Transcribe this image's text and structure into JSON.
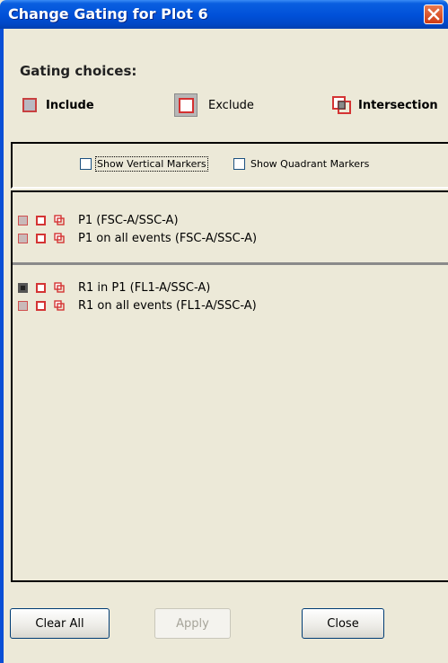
{
  "window": {
    "title": "Change Gating for Plot 6"
  },
  "gating": {
    "heading": "Gating choices:",
    "choices": [
      {
        "label": "Include"
      },
      {
        "label": "Exclude"
      },
      {
        "label": "Intersection"
      }
    ]
  },
  "markers": {
    "vertical_label": "Show Vertical Markers",
    "vertical_checked": false,
    "quadrant_label": "Show Quadrant Markers",
    "quadrant_checked": false
  },
  "groups": [
    {
      "rows": [
        {
          "label": "P1 (FSC-A/SSC-A)",
          "include_selected": false
        },
        {
          "label": "P1 on all events (FSC-A/SSC-A)",
          "include_selected": false
        }
      ]
    },
    {
      "rows": [
        {
          "label": "R1 in P1 (FL1-A/SSC-A)",
          "include_selected": true
        },
        {
          "label": "R1 on all events (FL1-A/SSC-A)",
          "include_selected": false
        }
      ]
    }
  ],
  "buttons": {
    "clear_all": "Clear All",
    "apply": "Apply",
    "apply_enabled": false,
    "close": "Close"
  }
}
